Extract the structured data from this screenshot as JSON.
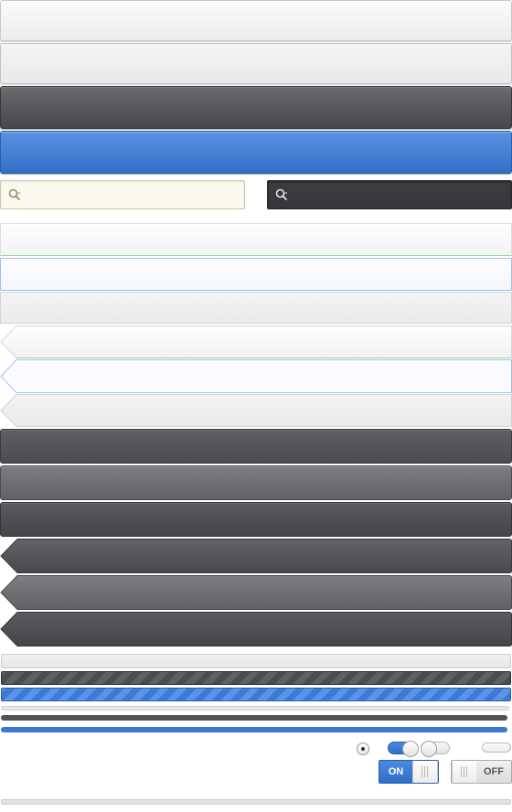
{
  "colors": {
    "accent_blue": "#3a78d2",
    "dark_gray": "#4a4b4e",
    "light_gray": "#ededed",
    "search_light_bg": "#fbf8ee",
    "search_dark_bg": "#3a3b3e",
    "valid_green": "#9fd09f",
    "focus_blue": "#9cc1ee"
  },
  "icons": {
    "search": "search-icon",
    "radio": "radio-dot-icon",
    "grip": "grip-lines-icon"
  },
  "search_fields": {
    "light_placeholder": "",
    "dark_placeholder": ""
  },
  "progress": {
    "track_value": 0,
    "dark_striped_value": 1.0,
    "blue_striped_value": 1.0
  },
  "controls": {
    "radio_selected": true,
    "mini_toggle_1_on": true,
    "mini_toggle_2_on": false,
    "switch_on_label": "ON",
    "switch_off_label": "OFF"
  }
}
